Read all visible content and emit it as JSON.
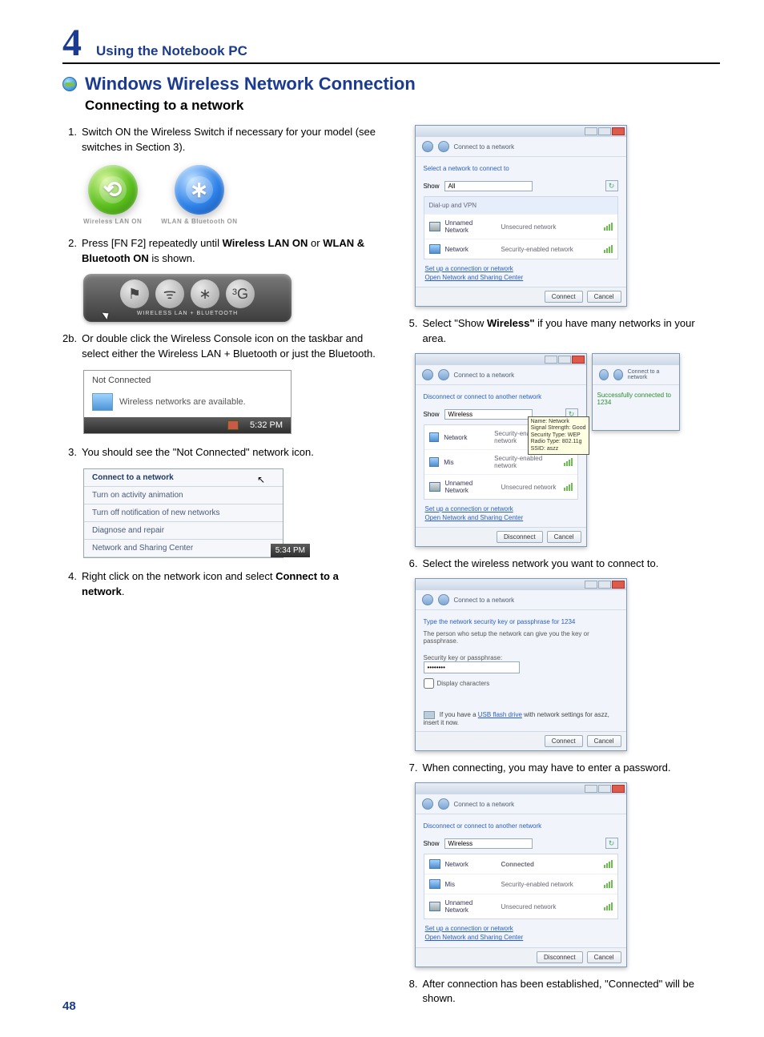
{
  "chapter": {
    "number": "4",
    "title": "Using the Notebook PC"
  },
  "heading": "Windows Wireless Network Connection",
  "subheading": "Connecting to a network",
  "page_number": "48",
  "left_steps": {
    "s1": "Switch ON the Wireless Switch if necessary for your model (see switches in Section 3).",
    "badge1": "Wireless LAN ON",
    "badge2": "WLAN & Bluetooth ON",
    "s2_a": "Press [FN F2] repeatedly until ",
    "s2_b": "Wireless LAN ON",
    "s2_c": " or ",
    "s2_d": "WLAN & Bluetooth ON",
    "s2_e": " is shown.",
    "console_label": "WIRELESS LAN + BLUETOOTH",
    "s2b_num": "2b.",
    "s2b": "Or double click the Wireless Console icon on the taskbar and select either the Wireless LAN + Bluetooth or just the Bluetooth.",
    "nc_title": "Not Connected",
    "nc_msg": "Wireless networks are available.",
    "nc_time": "5:32 PM",
    "s3": "You should see the \"Not Connected\" network icon.",
    "menu": {
      "m1": "Connect to a network",
      "m2": "Turn on activity animation",
      "m3": "Turn off notification of new networks",
      "m4": "Diagnose and repair",
      "m5": "Network and Sharing Center",
      "time": "5:34 PM"
    },
    "s4_a": "Right click on the network icon and select ",
    "s4_b": "Connect to a network",
    "s4_c": "."
  },
  "win_common": {
    "crumb": "Connect to a network",
    "show": "Show",
    "link1": "Set up a connection or network",
    "link2": "Open Network and Sharing Center",
    "connect": "Connect",
    "cancel": "Cancel",
    "disconnect": "Disconnect"
  },
  "win5": {
    "prompt": "Select a network to connect to",
    "dd": "All",
    "opt1": "Dial-up and VPN",
    "row1_name": "",
    "row1_desc": "",
    "row2_name": "Unnamed Network",
    "row2_desc": "Unsecured network",
    "row3_name": "Network",
    "row3_desc": "Security-enabled network"
  },
  "right_steps": {
    "s5_a": "Select \"Show ",
    "s5_b": "Wireless\"",
    "s5_c": " if you have many networks in your area.",
    "s6": "Select the wireless network you want to connect to.",
    "s7": "When connecting, you may have to enter a password.",
    "s8": "After connection has been established, \"Connected\" will be shown."
  },
  "win6": {
    "prompt": "Disconnect or connect to another network",
    "dd": "Wireless",
    "row1_name": "Network",
    "row1_desc": "Security-enabled network",
    "row2_name": "Mis",
    "row2_desc": "Security-enabled network",
    "row3_name": "Unnamed Network",
    "row3_desc": "Unsecured network",
    "tooltip": "Name: Network\nSignal Strength: Good\nSecurity Type: WEP\nRadio Type: 802.11g\nSSID: aszz",
    "ok": "Successfully connected to 1234"
  },
  "win7": {
    "prompt": "Type the network security key or passphrase for 1234",
    "hint": "The person who setup the network can give you the key or passphrase.",
    "label": "Security key or passphrase:",
    "value": "••••••••",
    "chk": "Display characters",
    "note_a": "If you have a ",
    "note_b": "USB flash drive",
    "note_c": " with network settings for aszz, insert it now."
  },
  "win8": {
    "prompt": "Disconnect or connect to another network",
    "dd": "Wireless",
    "row1_name": "Network",
    "row1_desc": "Connected",
    "row2_name": "Mis",
    "row2_desc": "Security-enabled network",
    "row3_name": "Unnamed Network",
    "row3_desc": "Unsecured network"
  }
}
